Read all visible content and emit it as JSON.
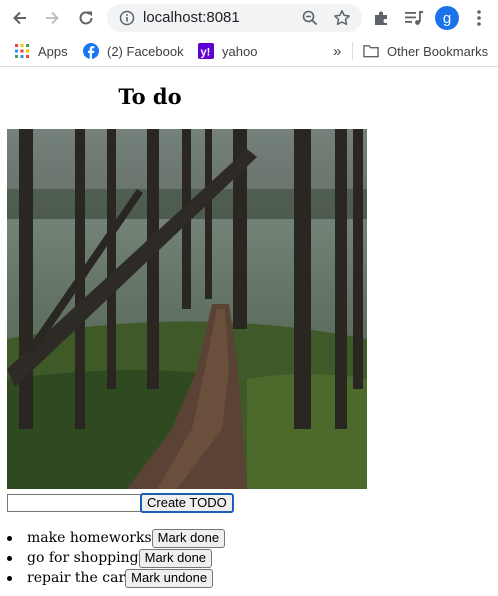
{
  "browser": {
    "url": "localhost:8081",
    "avatar_letter": "g",
    "bookmarks": [
      {
        "label": "Apps",
        "icon": "apps-grid-icon"
      },
      {
        "label": "(2) Facebook",
        "icon": "facebook-icon"
      },
      {
        "label": "yahoo",
        "icon": "yahoo-icon"
      }
    ],
    "overflow_label": "»",
    "other_bookmarks_label": "Other Bookmarks"
  },
  "page": {
    "title": "To do",
    "input": {
      "value": "",
      "placeholder": ""
    },
    "create_label": "Create TODO",
    "todos": [
      {
        "text": "make homeworks",
        "button": "Mark done"
      },
      {
        "text": "go for shopping",
        "button": "Mark done"
      },
      {
        "text": "repair the car",
        "button": "Mark undone"
      }
    ]
  },
  "colors": {
    "accent": "#1a73e8",
    "facebook": "#1877f2",
    "yahoo": "#6001d2"
  }
}
